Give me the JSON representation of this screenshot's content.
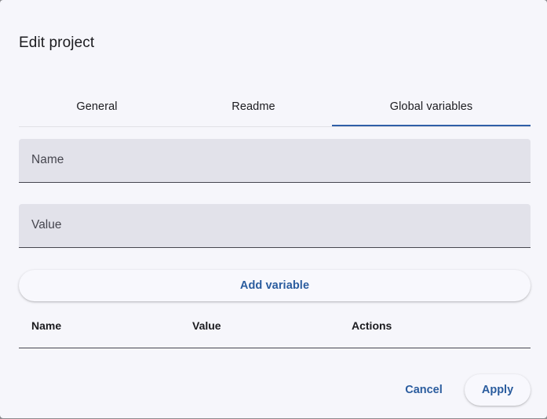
{
  "dialog": {
    "title": "Edit project"
  },
  "tabs": [
    {
      "label": "General",
      "active": false
    },
    {
      "label": "Readme",
      "active": false
    },
    {
      "label": "Global variables",
      "active": true
    }
  ],
  "form": {
    "name_placeholder": "Name",
    "name_value": "",
    "value_placeholder": "Value",
    "value_value": "",
    "add_button": "Add variable"
  },
  "table": {
    "columns": [
      "Name",
      "Value",
      "Actions"
    ],
    "rows": []
  },
  "actions": {
    "cancel": "Cancel",
    "apply": "Apply"
  },
  "colors": {
    "accent": "#2f5fa8",
    "button_text": "#2a5c9e",
    "field_bg": "#e2e2ea",
    "dialog_bg": "#f6f6fb"
  }
}
